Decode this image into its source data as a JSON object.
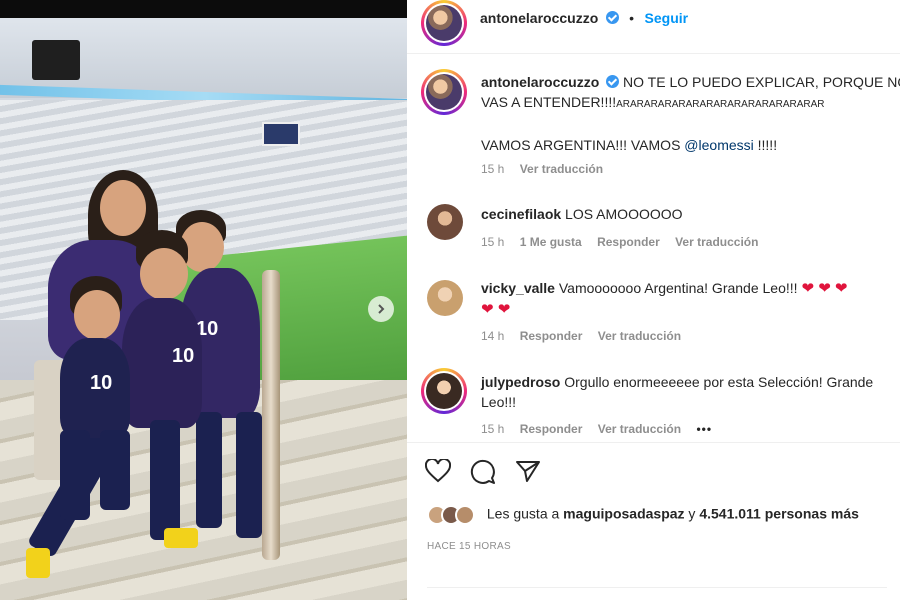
{
  "post": {
    "author": "antonelaroccuzzo",
    "follow_label": "Seguir",
    "separator": "•"
  },
  "caption": {
    "username": "antonelaroccuzzo",
    "line1": "NO TE LO PUEDO EXPLICAR, PORQUE NO",
    "line2_start": "VAS A ENTENDER!!!!",
    "line2_tail": "ARARARARARARARARARARARARARARAR",
    "line3_start": "VAMOS ARGENTINA!!! VAMOS ",
    "mention": "@leomessi",
    "line3_end": " !!!!!",
    "time": "15 h",
    "translate": "Ver traducción"
  },
  "comments": [
    {
      "username": "cecinefilaok",
      "text": "LOS AMOOOOOO",
      "time": "15 h",
      "likes": "1 Me gusta",
      "reply": "Responder",
      "translate": "Ver traducción"
    },
    {
      "username": "vicky_valle",
      "text": "Vamooooooo Argentina! Grande Leo!!!",
      "emoji_row1": "❤ ❤ ❤",
      "emoji_row2": "❤ ❤",
      "time": "14 h",
      "reply": "Responder",
      "translate": "Ver traducción"
    },
    {
      "username": "julypedroso",
      "text": "Orgullo enormeeeeee por esta Selección! Grande",
      "text_line2": "Leo!!!",
      "time": "15 h",
      "reply": "Responder",
      "translate": "Ver traducción",
      "more": "•••"
    }
  ],
  "likes": {
    "prefix": "Les gusta a ",
    "user": "maguiposadaspaz",
    "middle": " y ",
    "count": "4.541.011 personas más"
  },
  "timestamp": "HACE 15 HORAS",
  "photo": {
    "jersey_number": "10"
  },
  "colors": {
    "link": "#0095f6",
    "verified": "#3897f0",
    "heart": "#e0143c",
    "muted": "#8e8e8e",
    "text": "#262626"
  },
  "icons": [
    "heart-icon",
    "comment-icon",
    "share-icon",
    "next-arrow-icon",
    "verified-badge-icon"
  ]
}
